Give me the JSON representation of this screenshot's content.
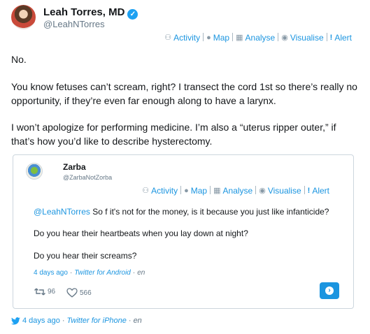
{
  "tweet": {
    "author_name": "Leah Torres, MD",
    "author_handle": "@LeahNTorres",
    "paragraphs": [
      "No.",
      "You know fetuses can’t scream, right? I transect the cord 1st so there’s really no opportunity, if they’re even far enough along to have a larynx.",
      "I won’t apologize for performing medicine. I’m also a “uterus ripper outer,” if that’s how you’d like to describe hysterectomy."
    ],
    "time": "4 days ago",
    "source": "Twitter for iPhone",
    "lang": "en"
  },
  "toolbar": {
    "activity": "Activity",
    "map": "Map",
    "analyse": "Analyse",
    "visualise": "Visualise",
    "alert": "Alert"
  },
  "quoted": {
    "author_name": "Zarba",
    "author_handle": "@ZarbaNotZorba",
    "mention": "@LeahNTorres",
    "line1_rest": " So f it's not for the money, is it because you just like infanticide?",
    "line2": "Do you hear their heartbeats when you lay down at night?",
    "line3": "Do you hear their screams?",
    "time": "4 days ago",
    "source": "Twitter for Android",
    "lang": "en",
    "retweets": "96",
    "likes": "566"
  },
  "icons": {
    "verified": "verified-badge-icon",
    "activity": "person-icon",
    "map": "globe-icon",
    "analyse": "table-icon",
    "visualise": "eye-icon",
    "alert": "exclamation-icon",
    "retweet": "retweet-icon",
    "like": "heart-icon",
    "open": "arrow-circle-icon",
    "twitter": "twitter-bird-icon"
  },
  "colors": {
    "link": "#1b95e0",
    "verified": "#1da1f2",
    "muted": "#657786",
    "border": "#ccd6dd"
  }
}
